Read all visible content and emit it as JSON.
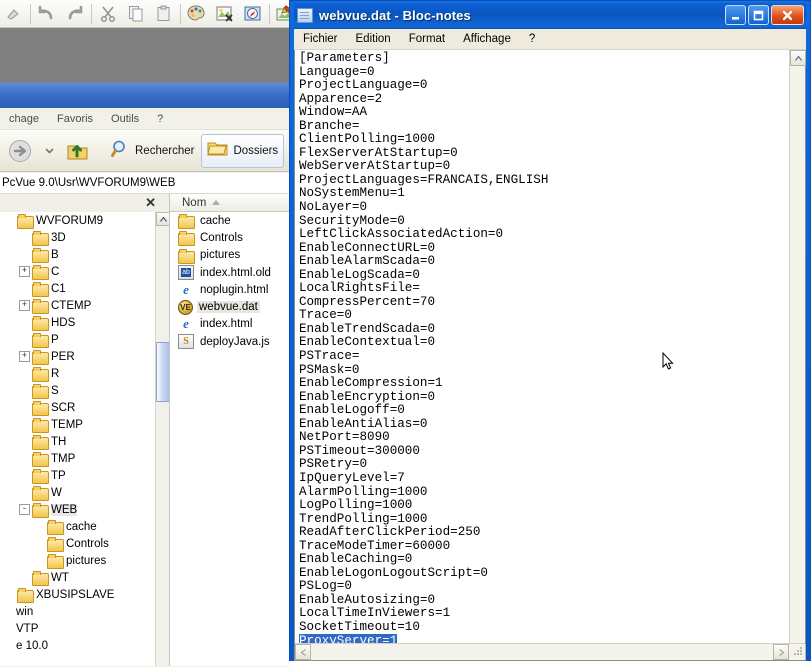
{
  "background_app": {
    "toolbar_icons": [
      "undo-icon",
      "redo-icon",
      "cut-icon",
      "copy-icon",
      "paste-icon",
      "palette-icon",
      "image-crop-icon",
      "image-view-icon",
      "image-edit-icon"
    ]
  },
  "explorer": {
    "menu": [
      "chage",
      "Favoris",
      "Outils",
      "?"
    ],
    "toolbar": {
      "forward_label": "",
      "up_label": "",
      "search_label": "Rechercher",
      "folders_label": "Dossiers",
      "views_label": ""
    },
    "address": "PcVue 9.0\\Usr\\WVFORUM9\\WEB",
    "tree_close_label": "✕",
    "tree": [
      {
        "label": "WVFORUM9",
        "indent": 0,
        "expander": "",
        "selected": false
      },
      {
        "label": "3D",
        "indent": 1,
        "expander": "",
        "selected": false
      },
      {
        "label": "B",
        "indent": 1,
        "expander": "",
        "selected": false
      },
      {
        "label": "C",
        "indent": 1,
        "expander": "+",
        "selected": false
      },
      {
        "label": "C1",
        "indent": 1,
        "expander": "",
        "selected": false
      },
      {
        "label": "CTEMP",
        "indent": 1,
        "expander": "+",
        "selected": false
      },
      {
        "label": "HDS",
        "indent": 1,
        "expander": "",
        "selected": false
      },
      {
        "label": "P",
        "indent": 1,
        "expander": "",
        "selected": false
      },
      {
        "label": "PER",
        "indent": 1,
        "expander": "+",
        "selected": false
      },
      {
        "label": "R",
        "indent": 1,
        "expander": "",
        "selected": false
      },
      {
        "label": "S",
        "indent": 1,
        "expander": "",
        "selected": false
      },
      {
        "label": "SCR",
        "indent": 1,
        "expander": "",
        "selected": false
      },
      {
        "label": "TEMP",
        "indent": 1,
        "expander": "",
        "selected": false
      },
      {
        "label": "TH",
        "indent": 1,
        "expander": "",
        "selected": false
      },
      {
        "label": "TMP",
        "indent": 1,
        "expander": "",
        "selected": false
      },
      {
        "label": "TP",
        "indent": 1,
        "expander": "",
        "selected": false
      },
      {
        "label": "W",
        "indent": 1,
        "expander": "",
        "selected": false
      },
      {
        "label": "WEB",
        "indent": 1,
        "expander": "-",
        "selected": true
      },
      {
        "label": "cache",
        "indent": 2,
        "expander": "",
        "selected": false
      },
      {
        "label": "Controls",
        "indent": 2,
        "expander": "",
        "selected": false
      },
      {
        "label": "pictures",
        "indent": 2,
        "expander": "",
        "selected": false
      },
      {
        "label": "WT",
        "indent": 1,
        "expander": "",
        "selected": false
      },
      {
        "label": "XBUSIPSLAVE",
        "indent": 0,
        "expander": "",
        "selected": false
      },
      {
        "label": "win",
        "indent": -1,
        "expander": "",
        "selected": false
      },
      {
        "label": "VTP",
        "indent": -1,
        "expander": "",
        "selected": false
      },
      {
        "label": "e 10.0",
        "indent": -1,
        "expander": "",
        "selected": false
      }
    ],
    "file_list": {
      "column_header": "Nom",
      "items": [
        {
          "name": "cache",
          "icon": "folder-icon",
          "selected": false
        },
        {
          "name": "Controls",
          "icon": "folder-icon",
          "selected": false
        },
        {
          "name": "pictures",
          "icon": "folder-icon",
          "selected": false
        },
        {
          "name": "index.html.old",
          "icon": "generic-file-icon",
          "selected": false
        },
        {
          "name": "noplugin.html",
          "icon": "internet-explorer-icon",
          "selected": false
        },
        {
          "name": "webvue.dat",
          "icon": "dat-file-icon",
          "selected": true
        },
        {
          "name": "index.html",
          "icon": "internet-explorer-icon",
          "selected": false
        },
        {
          "name": "deployJava.js",
          "icon": "javascript-file-icon",
          "selected": false
        }
      ]
    }
  },
  "notepad": {
    "title": "webvue.dat - Bloc-notes",
    "window_buttons": {
      "minimize": "–",
      "maximize": "❑",
      "close": "✕"
    },
    "menu": [
      "Fichier",
      "Edition",
      "Format",
      "Affichage",
      "?"
    ],
    "content": "[Parameters]\nLanguage=0\nProjectLanguage=0\nApparence=2\nWindow=AA\nBranche=\nClientPolling=1000\nFlexServerAtStartup=0\nWebServerAtStartup=0\nProjectLanguages=FRANCAIS,ENGLISH\nNoSystemMenu=1\nNoLayer=0\nSecurityMode=0\nLeftClickAssociatedAction=0\nEnableConnectURL=0\nEnableAlarmScada=0\nEnableLogScada=0\nLocalRightsFile=\nCompressPercent=70\nTrace=0\nEnableTrendScada=0\nEnableContextual=0\nPSTrace=\nPSMask=0\nEnableCompression=1\nEnableEncryption=0\nEnableLogoff=0\nEnableAntiAlias=0\nNetPort=8090\nPSTimeout=300000\nPSRetry=0\nIpQueryLevel=7\nAlarmPolling=1000\nLogPolling=1000\nTrendPolling=1000\nReadAfterClickPeriod=250\nTraceModeTimer=60000\nEnableCaching=0\nEnableLogonLogoutScript=0\nPSLog=0\nEnableAutosizing=0\nLocalTimeInViewers=1\nSocketTimeout=10\n",
    "selected_line": "ProxyServer=1",
    "scroll": {
      "up": "▲",
      "down": "▼",
      "left": "◄",
      "right": "►"
    }
  },
  "colors": {
    "titlebar_blue": "#0a57c4",
    "selection_blue": "#316ac5",
    "menubar": "#eeeade",
    "close_red": "#e2511c"
  }
}
